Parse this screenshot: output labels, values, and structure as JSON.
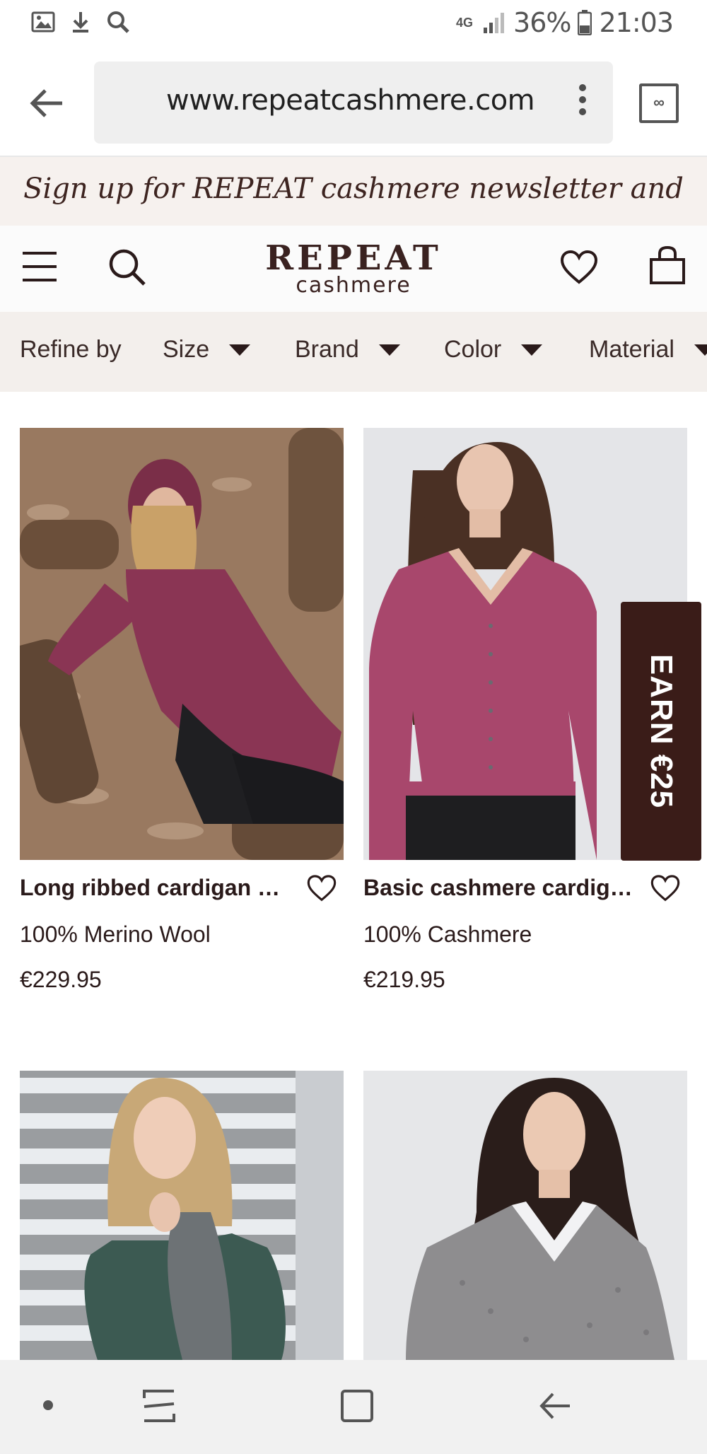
{
  "status_bar": {
    "network": "4G",
    "battery": "36%",
    "time": "21:03",
    "icons": [
      "image-icon",
      "download-icon",
      "search-icon",
      "signal-icon",
      "battery-icon"
    ]
  },
  "browser": {
    "url": "www.repeatcashmere.com",
    "icons": [
      "back-arrow-icon",
      "more-vert-icon",
      "tab-switcher-icon"
    ],
    "tab_glyph": "∞"
  },
  "promo": {
    "text": "Sign up for REPEAT cashmere newsletter and"
  },
  "header": {
    "logo_main": "REPEAT",
    "logo_sub": "cashmere",
    "icons": [
      "menu-icon",
      "search-icon",
      "heart-icon",
      "shopping-bag-icon"
    ]
  },
  "filters": {
    "label": "Refine by",
    "options": [
      "Size",
      "Brand",
      "Color",
      "Material"
    ]
  },
  "products": [
    {
      "name": "Long ribbed cardigan wi...",
      "material": "100% Merino Wool",
      "price": "€229.95"
    },
    {
      "name": "Basic cashmere cardiga...",
      "material": "100% Cashmere",
      "price": "€219.95"
    },
    {
      "name": "",
      "material": "",
      "price": ""
    },
    {
      "name": "",
      "material": "",
      "price": ""
    }
  ],
  "earn_tab": {
    "label": "EARN €25"
  },
  "colors": {
    "brand_dark": "#3a1c18",
    "promo_bg": "#f6f1ee",
    "filter_bg": "#f3efec"
  },
  "nav_bar": {
    "icons": [
      "dot-icon",
      "recent-apps-icon",
      "home-icon",
      "back-icon"
    ]
  }
}
